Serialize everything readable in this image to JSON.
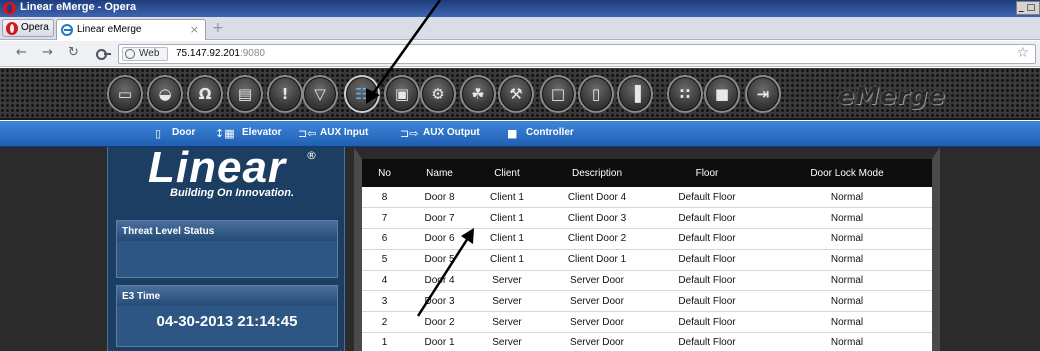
{
  "window": {
    "title": "Linear eMerge - Opera",
    "controls": "_ □"
  },
  "browser": {
    "menu_label": "Opera",
    "tab": {
      "label": "Linear eMerge",
      "close": "×"
    },
    "new_tab": "+",
    "nav": {
      "back": "←",
      "forward": "→",
      "reload": "↻"
    },
    "address": {
      "badge": "Web",
      "host": "75.147.92.201",
      "port": ":9080"
    },
    "bookmark": "☆"
  },
  "toolbar": {
    "buttons": [
      {
        "name": "monitor",
        "glyph": "▭"
      },
      {
        "name": "camera",
        "glyph": "◒"
      },
      {
        "name": "people",
        "glyph": "Ω"
      },
      {
        "name": "card",
        "glyph": "▤"
      },
      {
        "name": "alert",
        "glyph": "!"
      },
      {
        "name": "shield",
        "glyph": "▽"
      },
      {
        "name": "setup-doors",
        "glyph": "☷"
      },
      {
        "name": "badge-setup",
        "glyph": "▣"
      },
      {
        "name": "gears",
        "glyph": "⚙"
      },
      {
        "name": "network",
        "glyph": "☘"
      },
      {
        "name": "tools",
        "glyph": "⚒"
      },
      {
        "name": "save",
        "glyph": "□"
      },
      {
        "name": "document",
        "glyph": "▯"
      },
      {
        "name": "reports",
        "glyph": "▐"
      },
      {
        "name": "grid",
        "glyph": "∷"
      },
      {
        "name": "export",
        "glyph": "■"
      },
      {
        "name": "logout",
        "glyph": "⇥"
      }
    ],
    "logo": "eMerge"
  },
  "submenu": {
    "items": [
      {
        "icon": "▯",
        "label": "Door"
      },
      {
        "icon": "↕▦",
        "label": "Elevator"
      },
      {
        "icon": "⊐⇦",
        "label": "AUX Input"
      },
      {
        "icon": "⊐⇨",
        "label": "AUX Output"
      },
      {
        "icon": "■",
        "label": "Controller"
      }
    ]
  },
  "sidebar": {
    "logo": "Linear",
    "registered": "®",
    "tagline": "Building On Innovation.",
    "threat_title": "Threat Level Status",
    "time_title": "E3 Time",
    "time_value": "04-30-2013 21:14:45"
  },
  "doors_table": {
    "columns": [
      "No",
      "Name",
      "Client",
      "Description",
      "Floor",
      "Door Lock Mode"
    ],
    "rows": [
      [
        "8",
        "Door 8",
        "Client 1",
        "Client Door 4",
        "Default Floor",
        "Normal"
      ],
      [
        "7",
        "Door 7",
        "Client 1",
        "Client Door 3",
        "Default Floor",
        "Normal"
      ],
      [
        "6",
        "Door 6",
        "Client 1",
        "Client Door 2",
        "Default Floor",
        "Normal"
      ],
      [
        "5",
        "Door 5",
        "Client 1",
        "Client Door 1",
        "Default Floor",
        "Normal"
      ],
      [
        "4",
        "Door 4",
        "Server",
        "Server Door",
        "Default Floor",
        "Normal"
      ],
      [
        "3",
        "Door 3",
        "Server",
        "Server Door",
        "Default Floor",
        "Normal"
      ],
      [
        "2",
        "Door 2",
        "Server",
        "Server Door",
        "Default Floor",
        "Normal"
      ],
      [
        "1",
        "Door 1",
        "Server",
        "Server Door",
        "Default Floor",
        "Normal"
      ]
    ]
  }
}
